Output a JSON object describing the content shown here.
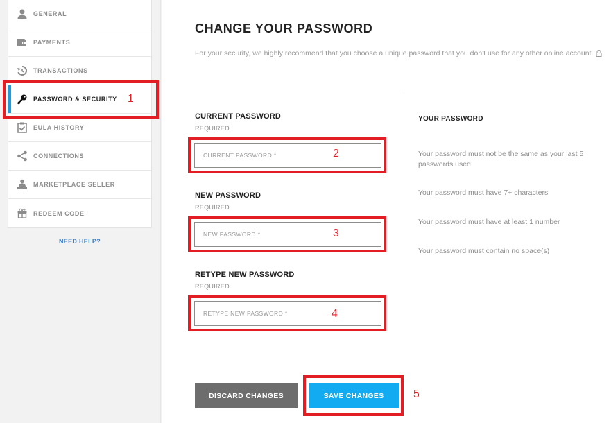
{
  "sidebar": {
    "items": [
      {
        "label": "General",
        "icon": "user-icon",
        "active": false
      },
      {
        "label": "Payments",
        "icon": "wallet-icon",
        "active": false
      },
      {
        "label": "Transactions",
        "icon": "history-icon",
        "active": false
      },
      {
        "label": "Password & Security",
        "icon": "key-icon",
        "active": true
      },
      {
        "label": "EULA History",
        "icon": "clipboard-check-icon",
        "active": false
      },
      {
        "label": "Connections",
        "icon": "share-icon",
        "active": false
      },
      {
        "label": "Marketplace Seller",
        "icon": "seller-icon",
        "active": false
      },
      {
        "label": "Redeem Code",
        "icon": "gift-icon",
        "active": false
      }
    ],
    "need_help": "NEED HELP?"
  },
  "main": {
    "title": "CHANGE YOUR PASSWORD",
    "description": "For your security, we highly recommend that you choose a unique password that you don't use for any other online account.",
    "fields": [
      {
        "label": "CURRENT PASSWORD",
        "required": "REQUIRED",
        "placeholder": "CURRENT PASSWORD *",
        "value": ""
      },
      {
        "label": "NEW PASSWORD",
        "required": "REQUIRED",
        "placeholder": "NEW PASSWORD *",
        "value": ""
      },
      {
        "label": "RETYPE NEW PASSWORD",
        "required": "REQUIRED",
        "placeholder": "RETYPE NEW PASSWORD *",
        "value": ""
      }
    ],
    "rules": {
      "title": "YOUR PASSWORD",
      "items": [
        "Your password must not be the same as your last 5 passwords used",
        "Your password must have 7+ characters",
        "Your password must have at least 1 number",
        "Your password must contain no space(s)"
      ]
    },
    "buttons": {
      "discard": "DISCARD CHANGES",
      "save": "SAVE CHANGES"
    }
  },
  "annotations": [
    "1",
    "2",
    "3",
    "4",
    "5"
  ],
  "colors": {
    "accent": "#12aaf0",
    "active_bar": "#1e9be0",
    "annotation": "#e31d24",
    "discard": "#6d6d6d"
  }
}
